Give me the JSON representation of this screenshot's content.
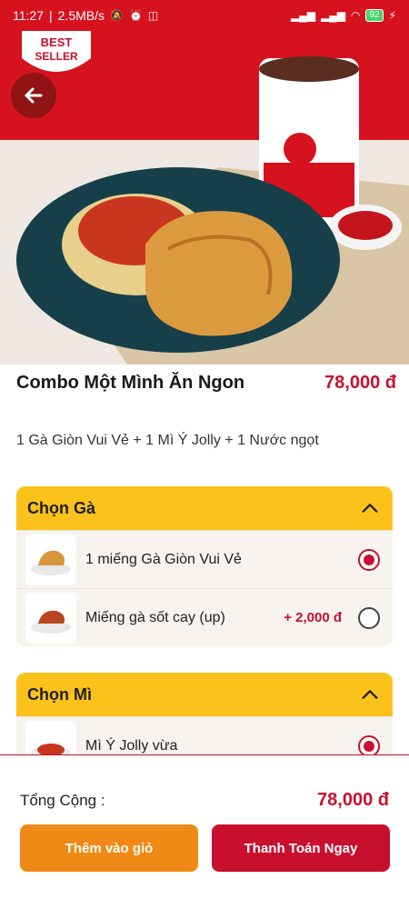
{
  "status_bar": {
    "time": "11:27",
    "speed": "2.5MB/s",
    "battery": "92"
  },
  "hero": {
    "badge_line1": "BEST",
    "badge_line2": "SELLER"
  },
  "product": {
    "title": "Combo Một Mình Ăn Ngon",
    "price": "78,000 đ",
    "description": "1 Gà Giòn Vui Vẻ + 1 Mì Ý Jolly + 1 Nước ngọt"
  },
  "groups": [
    {
      "title": "Chọn Gà",
      "options": [
        {
          "label": "1 miếng Gà Giòn Vui Vẻ",
          "extra": "",
          "selected": true
        },
        {
          "label": "Miếng gà sốt cay (up)",
          "extra": "+ 2,000 đ",
          "selected": false
        }
      ]
    },
    {
      "title": "Chọn Mì",
      "options": [
        {
          "label": "Mì Ý Jolly vừa",
          "extra": "",
          "selected": true
        }
      ]
    }
  ],
  "footer": {
    "total_label": "Tổng Cộng :",
    "total_value": "78,000 đ",
    "add_to_cart": "Thêm vào giỏ",
    "checkout": "Thanh Toán Ngay"
  },
  "colors": {
    "brand_red": "#c8102e",
    "header_yellow": "#fbc21b",
    "button_orange": "#f08a16"
  }
}
